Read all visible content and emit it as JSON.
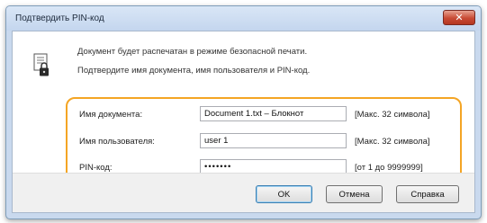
{
  "dialog": {
    "title": "Подтвердить PIN-код",
    "close_label": "✕"
  },
  "message": {
    "line1": "Документ будет распечатан в режиме безопасной печати.",
    "line2": "Подтвердите имя документа, имя пользователя и PIN-код."
  },
  "fields": {
    "document_name": {
      "label": "Имя документа:",
      "value": "Document 1.txt – Блокнот",
      "hint": "[Макс. 32 символа]"
    },
    "user_name": {
      "label": "Имя пользователя:",
      "value": "user 1",
      "hint": "[Макс. 32 символа]"
    },
    "pin": {
      "label": "PIN-код:",
      "value": "•••••••",
      "hint": "[от 1 до 9999999]"
    }
  },
  "buttons": {
    "ok": "OK",
    "cancel": "Отмена",
    "help": "Справка"
  },
  "colors": {
    "highlight": "#f4a524",
    "close_button": "#c84b35"
  },
  "icons": {
    "document": "document-lock-icon",
    "close": "close-icon"
  }
}
